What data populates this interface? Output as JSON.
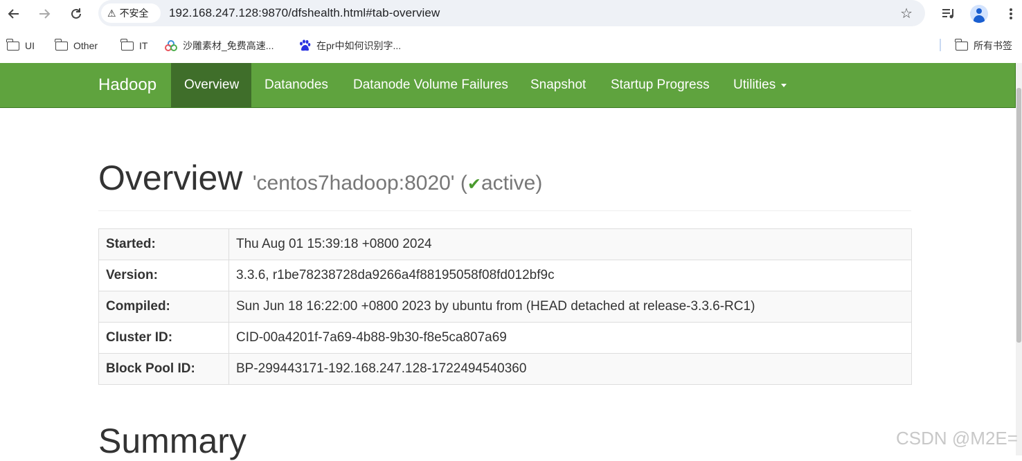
{
  "browser": {
    "security_label": "不安全",
    "url": "192.168.247.128:9870/dfshealth.html#tab-overview",
    "bookmarks": [
      {
        "label": "UI",
        "icon": "folder-icon"
      },
      {
        "label": "Other",
        "icon": "folder-icon"
      },
      {
        "label": "IT",
        "icon": "folder-icon"
      },
      {
        "label": "沙雕素材_免费高速...",
        "icon": "site-icon"
      },
      {
        "label": "在pr中如何识别字...",
        "icon": "baidu-paw-icon"
      }
    ],
    "all_bookmarks_label": "所有书签"
  },
  "navbar": {
    "brand": "Hadoop",
    "items": [
      {
        "label": "Overview",
        "active": true
      },
      {
        "label": "Datanodes"
      },
      {
        "label": "Datanode Volume Failures"
      },
      {
        "label": "Snapshot"
      },
      {
        "label": "Startup Progress"
      },
      {
        "label": "Utilities"
      }
    ]
  },
  "overview": {
    "title": "Overview",
    "host": "'centos7hadoop:8020'",
    "paren_open": "(",
    "check": "✔",
    "state": "active)",
    "rows": [
      {
        "label": "Started:",
        "value": "Thu Aug 01 15:39:18 +0800 2024"
      },
      {
        "label": "Version:",
        "value": "3.3.6, r1be78238728da9266a4f88195058f08fd012bf9c"
      },
      {
        "label": "Compiled:",
        "value": "Sun Jun 18 16:22:00 +0800 2023 by ubuntu from (HEAD detached at release-3.3.6-RC1)"
      },
      {
        "label": "Cluster ID:",
        "value": "CID-00a4201f-7a69-4b88-9b30-f8e5ca807a69"
      },
      {
        "label": "Block Pool ID:",
        "value": "BP-299443171-192.168.247.128-1722494540360"
      }
    ]
  },
  "summary": {
    "title": "Summary"
  },
  "watermark": "CSDN @M2E=",
  "colors": {
    "navbar": "#5fa33e",
    "navbar_active": "#3f6e2a",
    "check": "#4a9a2e"
  }
}
